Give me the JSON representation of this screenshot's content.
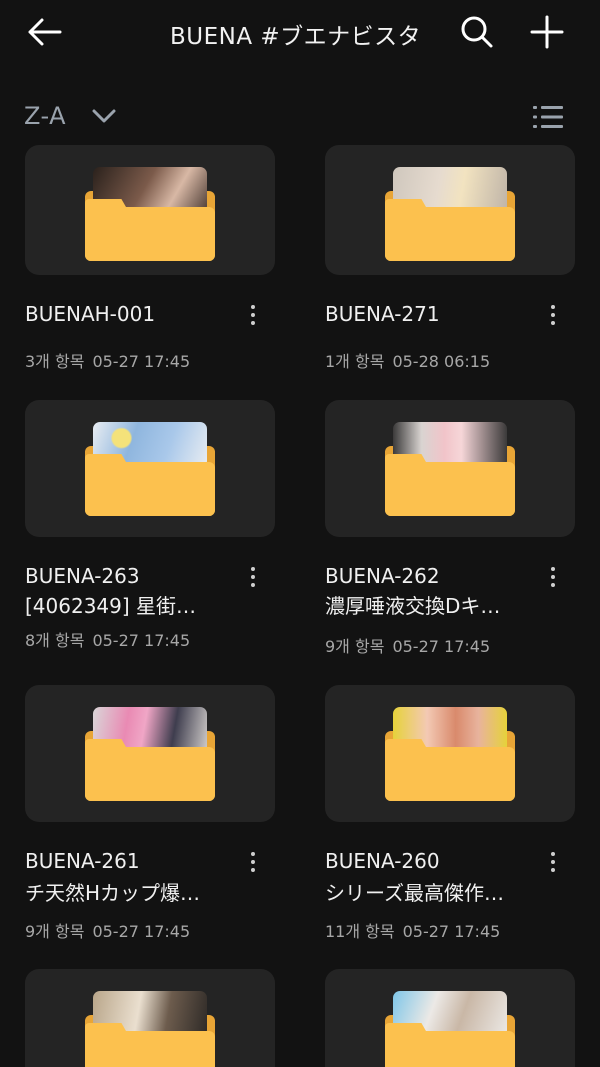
{
  "header": {
    "title": "BUENA #ブエナビスタ",
    "back_icon": "arrow-left-icon",
    "search_icon": "search-icon",
    "add_icon": "plus-icon"
  },
  "sort": {
    "label": "Z-A",
    "chevron_icon": "chevron-down-icon",
    "view_icon": "list-view-icon"
  },
  "colors": {
    "background": "#121212",
    "card": "#242424",
    "folder": "#fcc14e",
    "folder_back": "#e8a536"
  },
  "folders": [
    {
      "name": "BUENAH-001",
      "subtitle": "",
      "count": "3개 항목",
      "date": "05-27 17:45",
      "preview_colors": [
        "#2a211c",
        "#7b5a4a",
        "#d8b8a5"
      ]
    },
    {
      "name": "BUENA-271",
      "subtitle": "",
      "count": "1개 항목",
      "date": "05-28 06:15",
      "preview_colors": [
        "#cfc7bd",
        "#e6dbcf",
        "#f2e3c0"
      ]
    },
    {
      "name": "BUENA-263",
      "subtitle": "[4062349] 星街…",
      "count": "8개 항목",
      "date": "05-27 17:45",
      "preview_colors": [
        "#e9edf2",
        "#8fb6de",
        "#f4e27a"
      ]
    },
    {
      "name": "BUENA-262",
      "subtitle": "濃厚唾液交換Dキ…",
      "count": "9개 항목",
      "date": "05-27 17:45",
      "preview_colors": [
        "#3b3a3a",
        "#f1c4c9",
        "#d9d4d1"
      ]
    },
    {
      "name": "BUENA-261",
      "subtitle": "チ天然Hカップ爆…",
      "count": "9개 항목",
      "date": "05-27 17:45",
      "preview_colors": [
        "#d9d6d8",
        "#e98ab3",
        "#3e3d4e"
      ]
    },
    {
      "name": "BUENA-260",
      "subtitle": "シリーズ最高傑作…",
      "count": "11개 항목",
      "date": "05-27 17:45",
      "preview_colors": [
        "#e6d23a",
        "#d98a6c",
        "#f3c9b4"
      ]
    },
    {
      "name": "",
      "subtitle": "",
      "count": "",
      "date": "",
      "preview_colors": [
        "#b9a68a",
        "#6d5c4d",
        "#eadfcf"
      ]
    },
    {
      "name": "",
      "subtitle": "",
      "count": "",
      "date": "",
      "preview_colors": [
        "#7fc6e8",
        "#ece9e6",
        "#c9b7a6"
      ]
    }
  ]
}
